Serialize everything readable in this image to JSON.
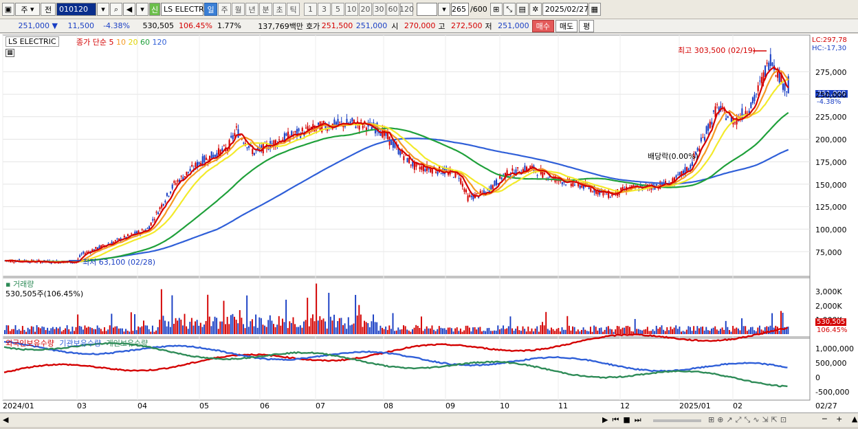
{
  "toolbar": {
    "type_label": "주",
    "flag_label": "전",
    "code": "010120",
    "name": "LS ELECTRI",
    "credit_label": "신",
    "periods": [
      {
        "label": "일",
        "active": true
      },
      {
        "label": "주"
      },
      {
        "label": "월"
      },
      {
        "label": "년"
      },
      {
        "label": "분"
      },
      {
        "label": "초"
      },
      {
        "label": "틱"
      }
    ],
    "minutes": [
      "1",
      "3",
      "5",
      "10",
      "20",
      "30",
      "60",
      "120"
    ],
    "count": "265",
    "count_max": "/600",
    "date": "2025/02/27"
  },
  "quote": {
    "price": "251,000",
    "arrow": "▼",
    "change": "11,500",
    "change_pct": "-4.38%",
    "volume": "530,505",
    "volume_pct": "106.45%",
    "turnover": "1.77%",
    "amount": "137,769백만",
    "bid_label": "호가",
    "bid": "251,500",
    "ask": "251,000",
    "open_label": "시",
    "open": "270,000",
    "high_label": "고",
    "high": "272,500",
    "low_label": "저",
    "low": "251,000",
    "buy_label": "매수",
    "sell_label": "매도",
    "eval_label": "평"
  },
  "price_panel": {
    "stock_name": "LS ELECTRIC",
    "ma_title": "종가 단순",
    "ma_periods": [
      "5",
      "10",
      "20",
      "60",
      "120"
    ],
    "lc": "LC:297,78",
    "hc": "HC:-17,30",
    "current_price": "251,000",
    "current_pct": "-4.38%",
    "high_note": "최고 303,500 (02/19)",
    "low_note": "최저 63,100 (02/28)",
    "dividend_note": "배당락(0.00%)",
    "y_ticks": [
      "275,000",
      "250,000",
      "225,000",
      "200,000",
      "175,000",
      "150,000",
      "125,000",
      "100,000",
      "75,000"
    ]
  },
  "volume_panel": {
    "title": "거래량",
    "value": "530,505주(106.45%)",
    "y_ticks": [
      "3,000K",
      "2,000K",
      "1,000K"
    ],
    "current": "530,505",
    "current_pct": "106.45%"
  },
  "holdings_panel": {
    "series": [
      {
        "name": "외국인보유수량",
        "color": "#d40000"
      },
      {
        "name": "기관보유수량",
        "color": "#2f5fd8"
      },
      {
        "name": "개인보유수량",
        "color": "#2e8b57"
      }
    ],
    "y_ticks": [
      "1,000,000",
      "500,000",
      "0",
      "-500,000"
    ]
  },
  "x_axis": {
    "labels": [
      "2024/01",
      "03",
      "04",
      "05",
      "06",
      "07",
      "08",
      "09",
      "10",
      "11",
      "12",
      "2025/01",
      "02",
      "02/27"
    ]
  },
  "colors": {
    "up": "#d40000",
    "down": "#1a3fc4",
    "ma5": "#d40000",
    "ma10": "#f59a23",
    "ma20": "#f3ea2a",
    "ma60": "#1fa03a",
    "ma120": "#2f5fd8"
  },
  "chart_data": [
    {
      "type": "candlestick",
      "title": "LS ELECTRIC",
      "y_axis_ticks": [
        75000,
        100000,
        125000,
        150000,
        175000,
        200000,
        225000,
        250000,
        275000
      ],
      "x_labels": [
        "2024/01",
        "03",
        "04",
        "05",
        "06",
        "07",
        "08",
        "09",
        "10",
        "11",
        "12",
        "2025/01",
        "02"
      ],
      "last_close": 251000,
      "period_high": 303500,
      "period_low": 63100,
      "approx_close": [
        [
          0,
          65000
        ],
        [
          20,
          64000
        ],
        [
          40,
          63500
        ],
        [
          43,
          72000
        ],
        [
          60,
          85000
        ],
        [
          80,
          100000
        ],
        [
          95,
          150000
        ],
        [
          110,
          175000
        ],
        [
          125,
          190000
        ],
        [
          130,
          210000
        ],
        [
          140,
          185000
        ],
        [
          155,
          200000
        ],
        [
          170,
          210000
        ],
        [
          180,
          215000
        ],
        [
          195,
          218000
        ],
        [
          210,
          212000
        ],
        [
          220,
          190000
        ],
        [
          230,
          170000
        ],
        [
          245,
          165000
        ],
        [
          255,
          160000
        ],
        [
          260,
          135000
        ],
        [
          270,
          140000
        ],
        [
          280,
          160000
        ],
        [
          295,
          168000
        ],
        [
          310,
          155000
        ],
        [
          325,
          148000
        ],
        [
          340,
          138000
        ],
        [
          350,
          145000
        ],
        [
          365,
          148000
        ],
        [
          375,
          152000
        ],
        [
          385,
          170000
        ],
        [
          400,
          235000
        ],
        [
          410,
          220000
        ],
        [
          420,
          240000
        ],
        [
          430,
          290000
        ],
        [
          440,
          251000
        ]
      ],
      "moving_averages": [
        {
          "name": "5",
          "color": "#d40000"
        },
        {
          "name": "10",
          "color": "#f59a23"
        },
        {
          "name": "20",
          "color": "#f3ea2a"
        },
        {
          "name": "60",
          "color": "#1fa03a"
        },
        {
          "name": "120",
          "color": "#2f5fd8"
        }
      ]
    },
    {
      "type": "bar",
      "title": "거래량",
      "y_axis_ticks": [
        "1,000K",
        "2,000K",
        "3,000K"
      ],
      "last_value": 530505
    },
    {
      "type": "line",
      "series": [
        {
          "name": "외국인보유수량",
          "start": -300000,
          "end": 1100000
        },
        {
          "name": "기관보유수량",
          "start": 600000,
          "end": -200000
        },
        {
          "name": "개인보유수량",
          "start": 700000,
          "end": -600000
        }
      ],
      "y_axis_ticks": [
        -500000,
        0,
        500000,
        1000000
      ]
    }
  ]
}
